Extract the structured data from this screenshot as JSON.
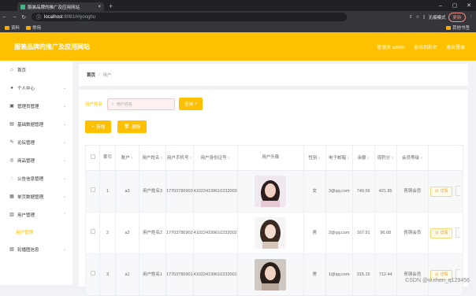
{
  "browser": {
    "tab_title": "服装品牌的推广及应用网站",
    "url_host": "localhost",
    "url_rest": ":8081/#/yonghu",
    "incognito": "无痕模式",
    "update": "更新",
    "bookmarks": [
      "资料",
      "常用"
    ],
    "bookmarks_right": "其他书签"
  },
  "header": {
    "title": "服装品牌的推广及应用网站",
    "links": [
      "管理员 admin",
      "退出到前台",
      "退出登录"
    ]
  },
  "sidebar": {
    "items": [
      {
        "icon": "home-icon",
        "label": "首页",
        "has_chevron": false
      },
      {
        "icon": "person-icon",
        "label": "个人中心",
        "has_chevron": true
      },
      {
        "icon": "admin-icon",
        "label": "管理员管理",
        "has_chevron": true
      },
      {
        "icon": "data-icon",
        "label": "基础数据管理",
        "has_chevron": true
      },
      {
        "icon": "forum-icon",
        "label": "论坛管理",
        "has_chevron": true
      },
      {
        "icon": "product-icon",
        "label": "商品管理",
        "has_chevron": true
      },
      {
        "icon": "notice-icon",
        "label": "公告信息管理",
        "has_chevron": true
      },
      {
        "icon": "page-icon",
        "label": "单页数据管理",
        "has_chevron": true
      },
      {
        "icon": "users-icon",
        "label": "用户管理",
        "has_chevron": true
      },
      {
        "icon": "carousel-icon",
        "label": "轮播图信息",
        "has_chevron": true
      }
    ],
    "active_sub": "用户管理"
  },
  "breadcrumb": {
    "home": "首页",
    "current": "用户"
  },
  "search": {
    "label": "用户姓名",
    "placeholder": "用户姓名",
    "button": "查询"
  },
  "actions": {
    "add": "新增",
    "delete": "删除"
  },
  "table": {
    "headers": [
      "索引",
      "账户",
      "用户姓名",
      "用户手机号",
      "用户身份证号",
      "用户头像",
      "性别",
      "电子邮箱",
      "余额",
      "现积分",
      "会员等级"
    ],
    "rows": [
      {
        "index": "1",
        "account": "a3",
        "name": "用户姓名3",
        "phone": "17703786903",
        "idcard": "410224199610232003",
        "gender": "女",
        "email": "3@qq.com",
        "balance": "749.56",
        "points": "421.85",
        "level": "青铜会员"
      },
      {
        "index": "2",
        "account": "a2",
        "name": "用户姓名2",
        "phone": "17703786902",
        "idcard": "410224199610232002",
        "gender": "男",
        "email": "2@qq.com",
        "balance": "167.91",
        "points": "96.08",
        "level": "青铜会员"
      },
      {
        "index": "3",
        "account": "a1",
        "name": "用户姓名1",
        "phone": "17703786901",
        "idcard": "410224199610232001",
        "gender": "男",
        "email": "1@qq.com",
        "balance": "315.15",
        "points": "712.44",
        "level": "青铜会员"
      }
    ],
    "detail_label": "详情"
  },
  "watermark": "CSDN @w.chen_q123456",
  "colors": {
    "accent": "#ffc000"
  }
}
